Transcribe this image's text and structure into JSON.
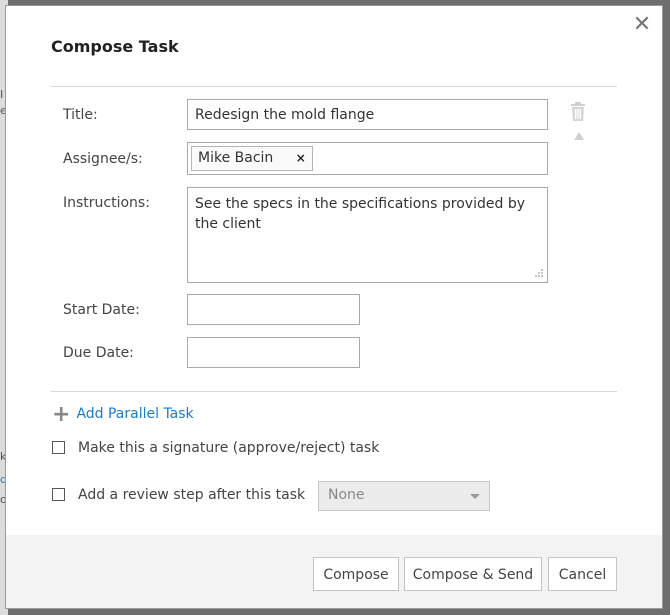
{
  "dialog": {
    "title": "Compose Task",
    "close_glyph": "✕"
  },
  "form": {
    "title_label": "Title:",
    "title_value": "Redesign the mold flange",
    "assignee_label": "Assignee/s:",
    "assignees": [
      {
        "name": "Mike Bacin",
        "remove_glyph": "×"
      }
    ],
    "instructions_label": "Instructions:",
    "instructions_value": "See the specs in the specifications provided by the client",
    "start_date_label": "Start Date:",
    "start_date_value": "",
    "due_date_label": "Due Date:",
    "due_date_value": ""
  },
  "actions": {
    "add_parallel_task": "Add Parallel Task",
    "signature_task_label": "Make this a signature (approve/reject) task",
    "signature_task_checked": false,
    "review_step_label": "Add a review step after this task",
    "review_step_checked": false,
    "review_select_value": "None"
  },
  "footer": {
    "compose": "Compose",
    "compose_send": "Compose & Send",
    "cancel": "Cancel"
  },
  "icons": {
    "trash": "trash-icon",
    "move_up": "arrow-up-icon",
    "calendar": "calendar-icon",
    "plus": "plus-icon",
    "close": "close-icon"
  },
  "colors": {
    "link": "#1a7cc7",
    "overlay": "#6e6e6e",
    "footer_bg": "#f3f3f3"
  }
}
